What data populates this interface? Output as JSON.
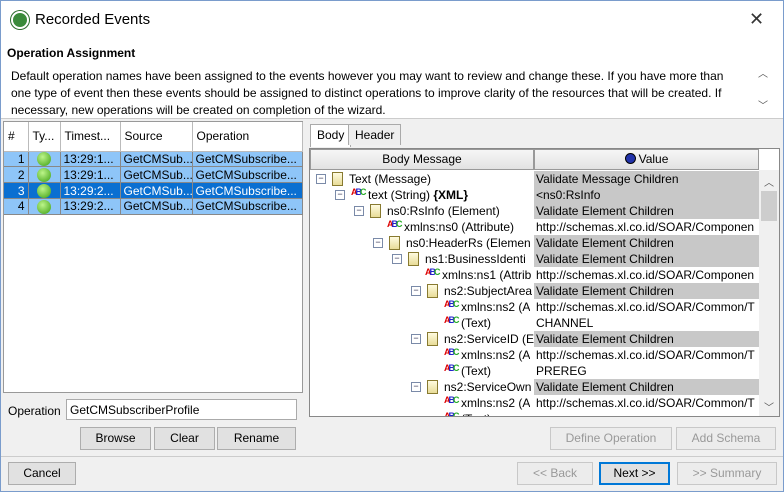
{
  "window": {
    "title": "Recorded Events",
    "close": "✕"
  },
  "section": {
    "heading": "Operation Assignment",
    "description": "Default operation names have been assigned to the events however you may want to review and change these. If you have more than one type of event then these events should be assigned to distinct operations to improve clarity of the resources that will be created. If necessary, new operations will be created on completion of the wizard."
  },
  "events": {
    "columns": [
      "#",
      "Ty...",
      "Timest...",
      "Source",
      "Operation"
    ],
    "rows": [
      {
        "num": "1",
        "timestamp": "13:29:1...",
        "source": "GetCMSub...",
        "operation": "GetCMSubscribe...",
        "selected": false,
        "type_icon": "outbound-event-icon"
      },
      {
        "num": "2",
        "timestamp": "13:29:1...",
        "source": "GetCMSub...",
        "operation": "GetCMSubscribe...",
        "selected": false,
        "type_icon": "outbound-event-icon"
      },
      {
        "num": "3",
        "timestamp": "13:29:2...",
        "source": "GetCMSub...",
        "operation": "GetCMSubscribe...",
        "selected": true,
        "type_icon": "request-reply-event-icon"
      },
      {
        "num": "4",
        "timestamp": "13:29:2...",
        "source": "GetCMSub...",
        "operation": "GetCMSubscribe...",
        "selected": false,
        "type_icon": "request-reply-event-icon"
      }
    ]
  },
  "operation": {
    "label": "Operation",
    "value": "GetCMSubscriberProfile",
    "browse": "Browse",
    "clear": "Clear",
    "rename": "Rename"
  },
  "tabs": [
    "Body",
    "Header"
  ],
  "tree": {
    "col_message": "Body Message",
    "col_value": "Value",
    "rows": [
      {
        "label": "Text (Message)",
        "value": "Validate Message Children",
        "icon": "doc",
        "depth": 0,
        "toggle": true,
        "gray": true
      },
      {
        "label": "text (String) ",
        "bold": "{XML}",
        "value": "<ns0:RsInfo",
        "icon": "abc",
        "depth": 1,
        "toggle": true,
        "gray": true
      },
      {
        "label": "ns0:RsInfo (Element)",
        "value": "Validate Element Children",
        "icon": "doc",
        "depth": 2,
        "toggle": true,
        "gray": true
      },
      {
        "label": "xmlns:ns0 (Attribute)",
        "value": "http://schemas.xl.co.id/SOAR/Componen",
        "icon": "abc",
        "depth": 3,
        "toggle": false,
        "gray": false
      },
      {
        "label": "ns0:HeaderRs (Elemen",
        "value": "Validate Element Children",
        "icon": "doc",
        "depth": 3,
        "toggle": true,
        "gray": true
      },
      {
        "label": "ns1:BusinessIdenti",
        "value": "Validate Element Children",
        "icon": "doc",
        "depth": 4,
        "toggle": true,
        "gray": true
      },
      {
        "label": "xmlns:ns1 (Attrib",
        "value": "http://schemas.xl.co.id/SOAR/Componen",
        "icon": "abc",
        "depth": 5,
        "toggle": false,
        "gray": false
      },
      {
        "label": "ns2:SubjectArea",
        "value": "Validate Element Children",
        "icon": "doc",
        "depth": 5,
        "toggle": true,
        "gray": true
      },
      {
        "label": "xmlns:ns2 (A",
        "value": "http://schemas.xl.co.id/SOAR/Common/T",
        "icon": "abc",
        "depth": 6,
        "toggle": false,
        "gray": false
      },
      {
        "label": "(Text)",
        "value": "CHANNEL",
        "icon": "abc",
        "depth": 6,
        "toggle": false,
        "gray": false
      },
      {
        "label": "ns2:ServiceID (E",
        "value": "Validate Element Children",
        "icon": "doc",
        "depth": 5,
        "toggle": true,
        "gray": true
      },
      {
        "label": "xmlns:ns2 (A",
        "value": "http://schemas.xl.co.id/SOAR/Common/T",
        "icon": "abc",
        "depth": 6,
        "toggle": false,
        "gray": false
      },
      {
        "label": "(Text)",
        "value": "PREREG",
        "icon": "abc",
        "depth": 6,
        "toggle": false,
        "gray": false
      },
      {
        "label": "ns2:ServiceOwn",
        "value": "Validate Element Children",
        "icon": "doc",
        "depth": 5,
        "toggle": true,
        "gray": true
      },
      {
        "label": "xmlns:ns2 (A",
        "value": "http://schemas.xl.co.id/SOAR/Common/T",
        "icon": "abc",
        "depth": 6,
        "toggle": false,
        "gray": false
      },
      {
        "label": "(Text)",
        "value": "",
        "icon": "abc",
        "depth": 6,
        "toggle": false,
        "gray": false
      }
    ]
  },
  "buttons": {
    "define_operation": "Define Operation",
    "add_schema": "Add Schema",
    "cancel": "Cancel",
    "back": "<< Back",
    "next": "Next >>",
    "summary": ">> Summary"
  }
}
